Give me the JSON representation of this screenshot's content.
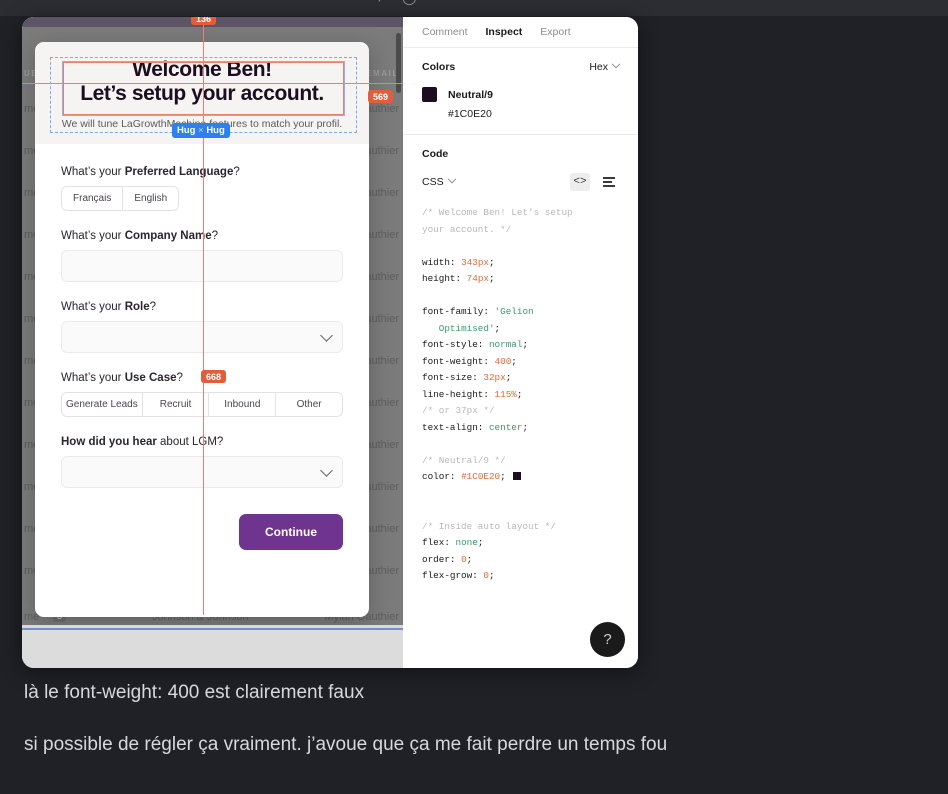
{
  "top_strip": {
    "glyph_fragment": "⌐◡"
  },
  "canvas": {
    "background_table": {
      "headers": [
        "UE",
        "",
        "EMAIL"
      ],
      "rows": [
        {
          "name": "me",
          "company": "",
          "person": "authier"
        },
        {
          "name": "me",
          "company": "",
          "person": "authier"
        },
        {
          "name": "me",
          "company": "",
          "person": "authier"
        },
        {
          "name": "me",
          "company": "",
          "person": "authier"
        },
        {
          "name": "me",
          "company": "",
          "person": "authier"
        },
        {
          "name": "me",
          "company": "",
          "person": "authier"
        },
        {
          "name": "me",
          "company": "",
          "person": "authier"
        },
        {
          "name": "me",
          "company": "",
          "person": "authier"
        },
        {
          "name": "me",
          "company": "",
          "person": "authier"
        },
        {
          "name": "me",
          "company": "",
          "person": "authier"
        },
        {
          "name": "me",
          "company": "",
          "person": "authier"
        },
        {
          "name": "me",
          "company": "",
          "person": "authier"
        }
      ],
      "last_row": {
        "name": "me",
        "badge": "3",
        "company": "Johnson & Johnson",
        "person": "Mylan Gauthier"
      }
    }
  },
  "modal": {
    "title_line1": "Welcome Ben!",
    "title_line2": "Let’s setup your account.",
    "subtitle": "We will tune LaGrowthMachine features to match your profil.",
    "fields": [
      {
        "label_prefix": "What’s your ",
        "label_bold": "Preferred Language",
        "label_suffix": "?",
        "type": "segmented",
        "options": [
          "Français",
          "English"
        ]
      },
      {
        "label_prefix": "What’s your ",
        "label_bold": "Company Name",
        "label_suffix": "?",
        "type": "text",
        "value": "",
        "placeholder": ""
      },
      {
        "label_prefix": "What’s your ",
        "label_bold": "Role",
        "label_suffix": "?",
        "type": "select",
        "value": ""
      },
      {
        "label_prefix": "What’s your ",
        "label_bold": "Use Case",
        "label_suffix": "?",
        "type": "segmented-full",
        "options": [
          "Generate Leads",
          "Recruit",
          "Inbound",
          "Other"
        ]
      },
      {
        "label_prefix": "",
        "label_bold": "How did you hear",
        "label_suffix": " about LGM?",
        "type": "select",
        "value": ""
      }
    ],
    "continue_label": "Continue"
  },
  "overlay": {
    "measurements": [
      {
        "value": "136"
      },
      {
        "value": "569"
      },
      {
        "value": "668"
      }
    ],
    "hug_chip": {
      "left": "Hug",
      "sep": "×",
      "right": "Hug"
    },
    "guide_color": "#e8806a",
    "selection_color": "#7aa8f0",
    "measure_color": "#e05e3c"
  },
  "inspect": {
    "tabs": [
      {
        "label": "Comment",
        "active": false
      },
      {
        "label": "Inspect",
        "active": true
      },
      {
        "label": "Export",
        "active": false
      }
    ],
    "colors_section": {
      "title": "Colors",
      "format": "Hex",
      "swatch_hex": "#1C0E20",
      "name": "Neutral/9",
      "hex": "#1C0E20"
    },
    "code_section": {
      "title": "Code",
      "language": "CSS",
      "comment_1a": "/* Welcome Ben! Let’s setup",
      "comment_1b": "your account. */",
      "prop_width_name": "width:",
      "prop_width_value": "343px",
      "prop_height_name": "height:",
      "prop_height_value": "74px",
      "prop_ff_name": "font-family:",
      "prop_ff_value_a": "'Gelion",
      "prop_ff_value_b": "Optimised'",
      "prop_fstyle_name": "font-style:",
      "prop_fstyle_value": "normal",
      "prop_fweight_name": "font-weight:",
      "prop_fweight_value": "400",
      "prop_fsize_name": "font-size:",
      "prop_fsize_value": "32px",
      "prop_lh_name": "line-height:",
      "prop_lh_value": "115%",
      "comment_lh": "/* or 37px */",
      "prop_talign_name": "text-align:",
      "prop_talign_value": "center",
      "comment_color": "/* Neutral/9 */",
      "prop_color_name": "color:",
      "prop_color_value": "#1C0E20",
      "comment_layout": "/* Inside auto layout */",
      "prop_flex_name": "flex:",
      "prop_flex_value": "none",
      "prop_order_name": "order:",
      "prop_order_value": "0",
      "prop_grow_name": "flex-grow:",
      "prop_grow_value": "0"
    },
    "help_label": "?"
  },
  "chat": {
    "messages": [
      "là le font-weight: 400 est clairement faux",
      "si possible de régler ça vraiment. j’avoue que ça me fait perdre un temps fou"
    ]
  }
}
